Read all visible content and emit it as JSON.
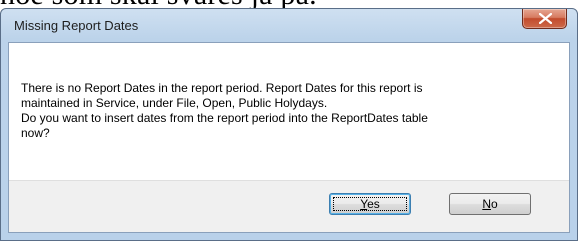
{
  "background_text": "noe som skal svares ja på.",
  "dialog": {
    "title": "Missing Report Dates",
    "message": "There is no Report Dates in the report period. Report Dates for this report is\nmaintained in Service, under File, Open, Public Holydays.\nDo you want to insert dates from the report period into the ReportDates table\nnow?",
    "close_icon": "close-icon",
    "buttons": {
      "yes": {
        "accel": "Y",
        "rest": "es"
      },
      "no": {
        "accel": "N",
        "rest": "o"
      }
    }
  }
}
